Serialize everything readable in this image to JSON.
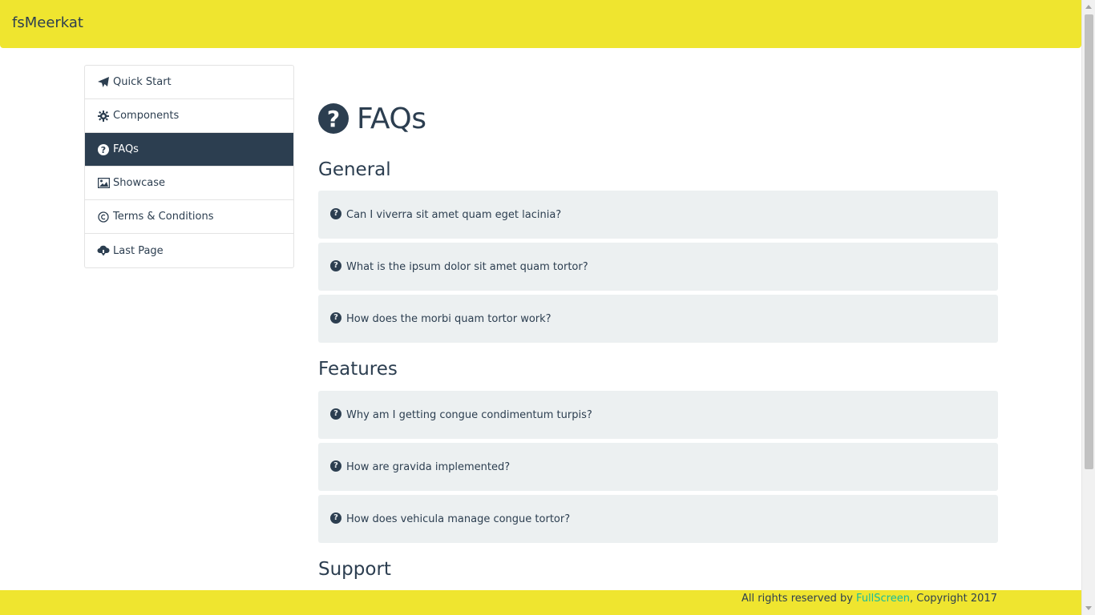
{
  "navbar": {
    "brand": "fsMeerkat",
    "background": "#efe52f"
  },
  "sidebar": {
    "items": [
      {
        "label": "Quick Start",
        "icon": "paper-plane-icon",
        "active": false
      },
      {
        "label": "Components",
        "icon": "gear-icon",
        "active": false
      },
      {
        "label": "FAQs",
        "icon": "question-circle-icon",
        "active": true
      },
      {
        "label": "Showcase",
        "icon": "picture-icon",
        "active": false
      },
      {
        "label": "Terms & Conditions",
        "icon": "copyright-icon",
        "active": false
      },
      {
        "label": "Last Page",
        "icon": "cloud-download-icon",
        "active": false
      }
    ],
    "active_color": "#2c3e50"
  },
  "main": {
    "title": "FAQs",
    "title_icon": "question-circle-icon",
    "sections": [
      {
        "heading": "General",
        "items": [
          "Can I viverra sit amet quam eget lacinia?",
          "What is the ipsum dolor sit amet quam tortor?",
          "How does the morbi quam tortor work?"
        ]
      },
      {
        "heading": "Features",
        "items": [
          "Why am I getting congue condimentum turpis?",
          "How are gravida implemented?",
          "How does vehicula manage congue tortor?"
        ]
      },
      {
        "heading": "Support",
        "items": []
      }
    ],
    "panel_color": "#ecf0f1"
  },
  "footer": {
    "prefix": "All rights reserved by ",
    "link": "FullScreen",
    "suffix": ", Copyright 2017",
    "link_color": "#18bc9c"
  }
}
